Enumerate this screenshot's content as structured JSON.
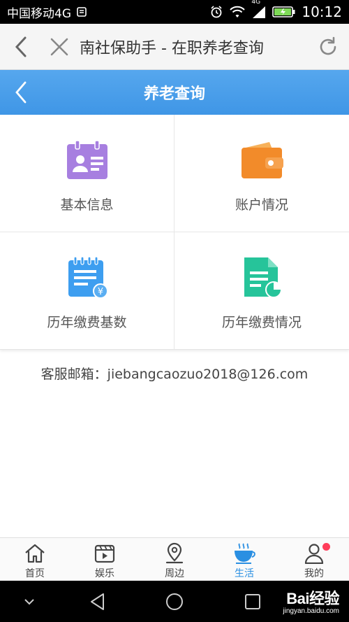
{
  "status_bar": {
    "carrier": "中国移动4G",
    "network_small": "4G",
    "time": "10:12"
  },
  "browser": {
    "title": "南社保助手 - 在职养老查询"
  },
  "header": {
    "title": "养老查询"
  },
  "grid": {
    "items": [
      {
        "label": "基本信息",
        "icon": "id-card-icon",
        "color": "#a77fe0"
      },
      {
        "label": "账户情况",
        "icon": "wallet-icon",
        "color": "#f28b2a"
      },
      {
        "label": "历年缴费基数",
        "icon": "notepad-yuan-icon",
        "color": "#3d9ef0"
      },
      {
        "label": "历年缴费情况",
        "icon": "document-chart-icon",
        "color": "#26c49a"
      }
    ]
  },
  "contact": {
    "email_line": "客服邮箱：jiebangcaozuo2018@126.com"
  },
  "tabbar": {
    "items": [
      {
        "label": "首页",
        "icon": "home-icon"
      },
      {
        "label": "娱乐",
        "icon": "video-icon"
      },
      {
        "label": "周边",
        "icon": "location-icon"
      },
      {
        "label": "生活",
        "icon": "coffee-icon",
        "active": true
      },
      {
        "label": "我的",
        "icon": "user-icon",
        "badge": true
      }
    ],
    "active_color": "#2a8fe2"
  },
  "watermark": {
    "logo": "Bai经验",
    "sub": "jingyan.baidu.com"
  },
  "colors": {
    "header_blue": "#4a9fea",
    "badge_red": "#ff3d5a"
  }
}
